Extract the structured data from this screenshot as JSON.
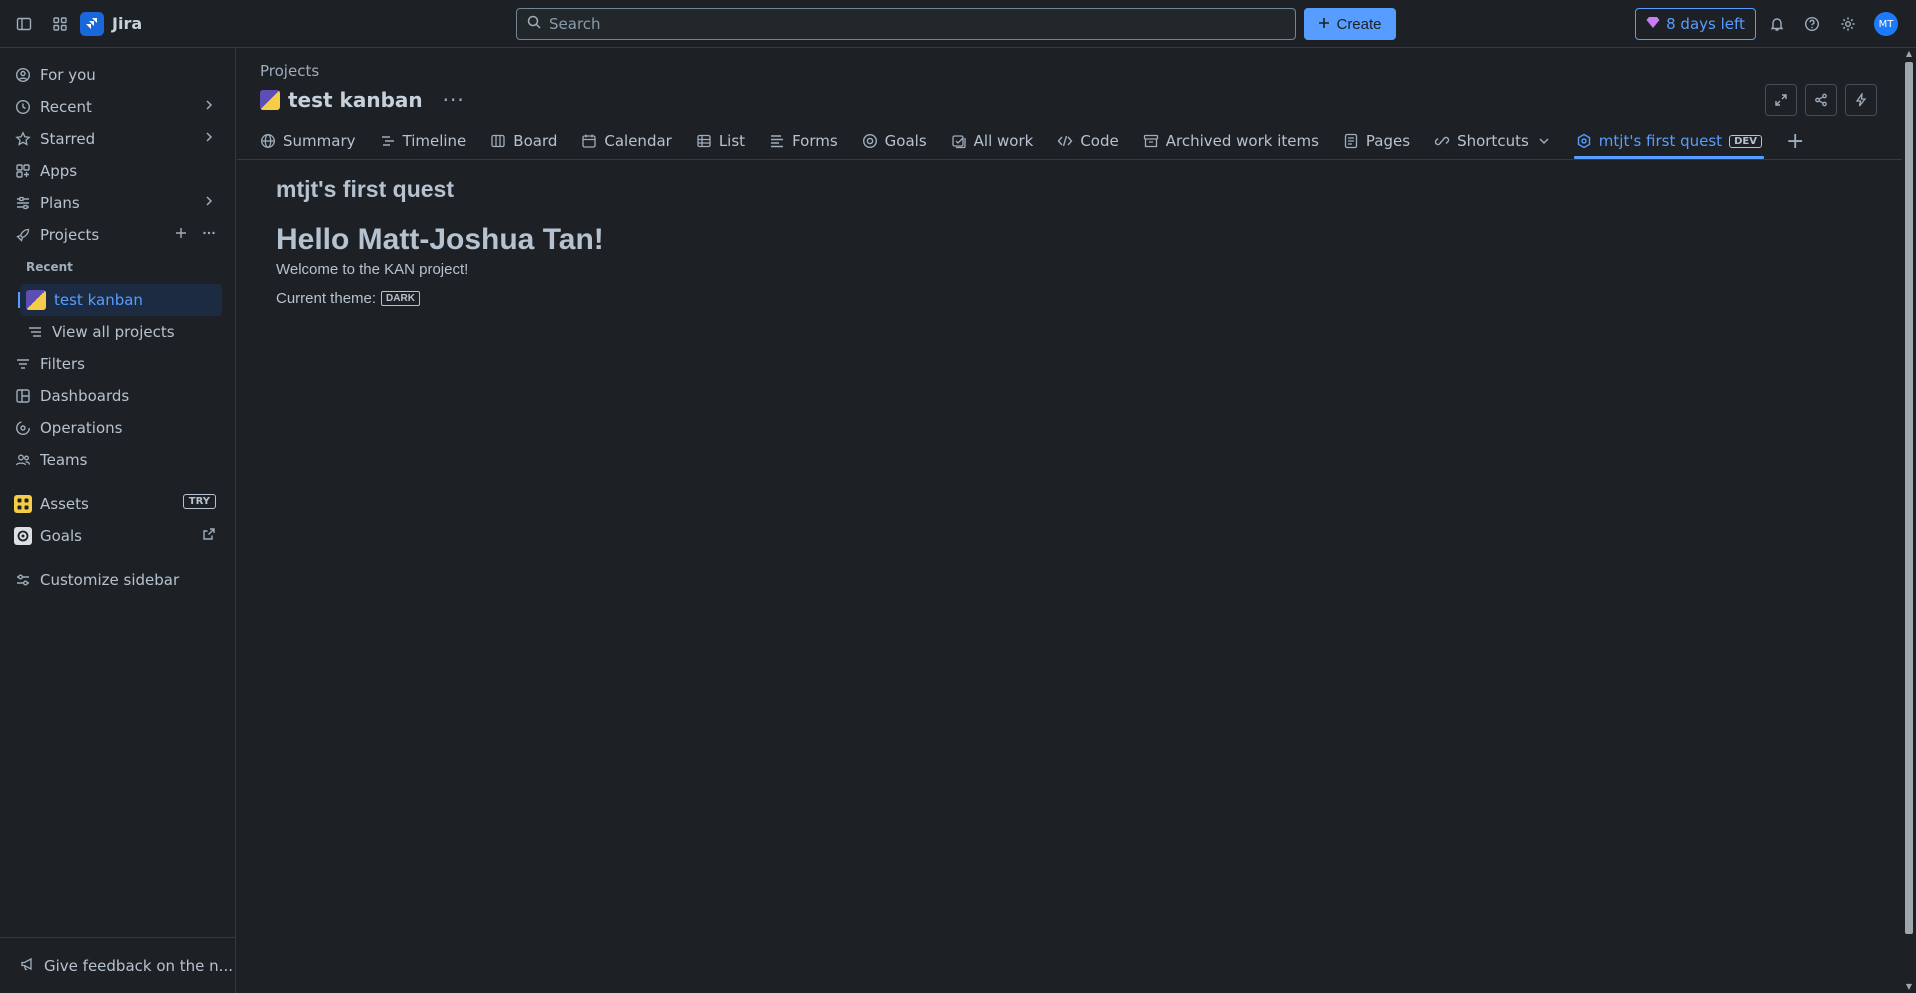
{
  "topbar": {
    "app_name": "Jira",
    "search_placeholder": "Search",
    "create_label": "Create",
    "trial_label": "8 days left",
    "avatar_initials": "MT"
  },
  "sidebar": {
    "items": [
      {
        "label": "For you"
      },
      {
        "label": "Recent"
      },
      {
        "label": "Starred"
      },
      {
        "label": "Apps"
      },
      {
        "label": "Plans"
      },
      {
        "label": "Projects"
      },
      {
        "label": "Filters"
      },
      {
        "label": "Dashboards"
      },
      {
        "label": "Operations"
      },
      {
        "label": "Teams"
      },
      {
        "label": "Assets",
        "badge": "TRY"
      },
      {
        "label": "Goals"
      },
      {
        "label": "Customize sidebar"
      }
    ],
    "recent_label": "Recent",
    "active_project": "test kanban",
    "view_all_projects": "View all projects",
    "feedback_label": "Give feedback on the n..."
  },
  "main": {
    "breadcrumb": "Projects",
    "project_title": "test kanban",
    "tabs": [
      {
        "label": "Summary"
      },
      {
        "label": "Timeline"
      },
      {
        "label": "Board"
      },
      {
        "label": "Calendar"
      },
      {
        "label": "List"
      },
      {
        "label": "Forms"
      },
      {
        "label": "Goals"
      },
      {
        "label": "All work"
      },
      {
        "label": "Code"
      },
      {
        "label": "Archived work items"
      },
      {
        "label": "Pages"
      },
      {
        "label": "Shortcuts"
      },
      {
        "label": "mtjt's first quest",
        "badge": "DEV"
      }
    ]
  },
  "content": {
    "quest_title": "mtjt's first quest",
    "hello": "Hello Matt-Joshua Tan!",
    "welcome": "Welcome to the KAN project!",
    "theme_label": "Current theme:",
    "theme_value": "DARK"
  },
  "colors": {
    "background": "#1d2125",
    "accent": "#579dff",
    "text": "#b6c2cf"
  }
}
